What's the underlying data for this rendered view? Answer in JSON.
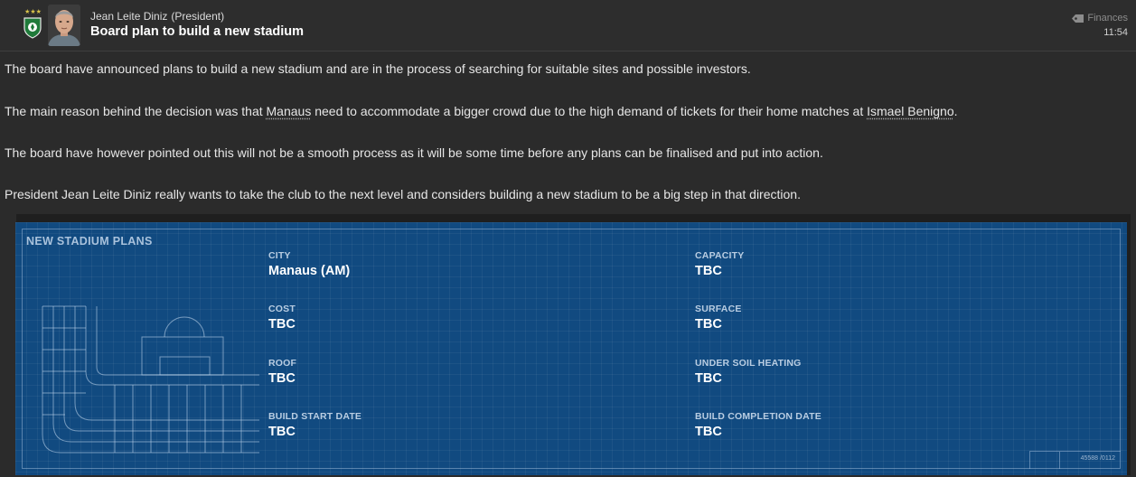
{
  "header": {
    "sender_name": "Jean Leite Diniz",
    "sender_role": "(President)",
    "subject": "Board plan to build a new stadium",
    "category": "Finances",
    "time": "11:54",
    "badge_stars": "★ ★ ★",
    "colors": {
      "club_green": "#1f7a3a",
      "club_white": "#ffffff"
    }
  },
  "body": {
    "p1": "The board have announced plans to build a new stadium and are in the process of searching for suitable sites and possible investors.",
    "p2_before": "The main reason behind the decision was that ",
    "p2_link1": "Manaus",
    "p2_middle": " need to accommodate a bigger crowd due to the high demand of tickets for their home matches at ",
    "p2_link2": "Ismael Benigno",
    "p2_after": ".",
    "p3": "The board have however pointed out this will not be a smooth process as it will be some time before any plans can be finalised and put into action.",
    "p4": "President Jean Leite Diniz really wants to take the club to the next level and considers building a new stadium to be a big step in that direction."
  },
  "panel": {
    "title": "NEW STADIUM PLANS",
    "background_color": "#114a80",
    "corner_code": "45588 /0112",
    "fields": {
      "city": {
        "label": "CITY",
        "value": "Manaus (AM)"
      },
      "capacity": {
        "label": "CAPACITY",
        "value": "TBC"
      },
      "cost": {
        "label": "COST",
        "value": "TBC"
      },
      "surface": {
        "label": "SURFACE",
        "value": "TBC"
      },
      "roof": {
        "label": "ROOF",
        "value": "TBC"
      },
      "under_soil_heating": {
        "label": "UNDER SOIL HEATING",
        "value": "TBC"
      },
      "build_start_date": {
        "label": "BUILD START DATE",
        "value": "TBC"
      },
      "build_completion_date": {
        "label": "BUILD COMPLETION DATE",
        "value": "TBC"
      }
    }
  }
}
